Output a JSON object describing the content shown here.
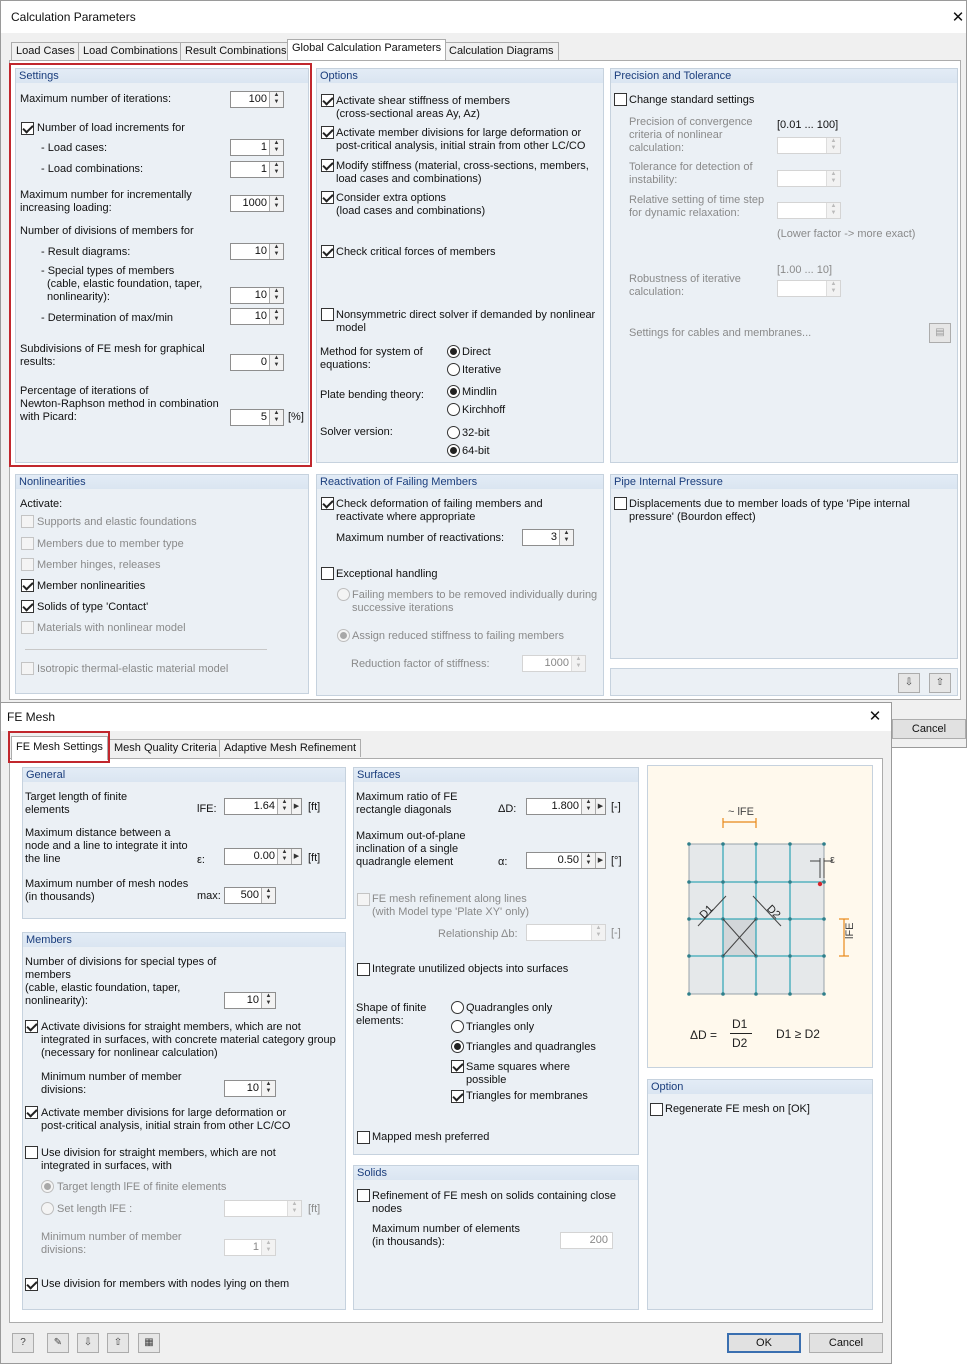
{
  "calc": {
    "title": "Calculation Parameters",
    "close": "✕",
    "tabs": [
      "Load Cases",
      "Load Combinations",
      "Result Combinations",
      "Global Calculation Parameters",
      "Calculation Diagrams"
    ],
    "settings": {
      "header": "Settings",
      "max_iter_label": "Maximum number of iterations:",
      "max_iter": "100",
      "num_load_inc_label": "Number of load increments for",
      "load_cases_label": "- Load cases:",
      "load_cases": "1",
      "load_combos_label": "- Load combinations:",
      "load_combos": "1",
      "max_incr_label1": "Maximum number for incrementally",
      "max_incr_label2": "increasing loading:",
      "max_incr": "1000",
      "divisions_label": "Number of divisions of members for",
      "result_diag_label": "- Result diagrams:",
      "result_diag": "10",
      "special_l1": "- Special types of members",
      "special_l2": "(cable, elastic foundation, taper,",
      "special_l3": "nonlinearity):",
      "special": "10",
      "maxmin_label": "- Determination of max/min",
      "maxmin": "10",
      "subdiv_l1": "Subdivisions of FE mesh for graphical",
      "subdiv_l2": "results:",
      "subdiv": "0",
      "pct_l1": "Percentage of iterations of",
      "pct_l2": "Newton-Raphson method in combination",
      "pct_l3": "with Picard:",
      "pct": "5",
      "pct_unit": "[%]"
    },
    "options": {
      "header": "Options",
      "shear_l1": "Activate shear stiffness of members",
      "shear_l2": "(cross-sectional areas Ay, Az)",
      "div_l1": "Activate member divisions for large deformation or",
      "div_l2": "post-critical analysis, initial strain from other LC/CO",
      "mod_l1": "Modify stiffness (material, cross-sections, members,",
      "mod_l2": "load cases and combinations)",
      "extra_l1": "Consider extra options",
      "extra_l2": "(load cases and combinations)",
      "crit": "Check critical forces of members",
      "nonsym_l1": "Nonsymmetric direct solver if demanded by nonlinear",
      "nonsym_l2": "model",
      "method_l1": "Method for system of",
      "method_l2": "equations:",
      "direct": "Direct",
      "iterative": "Iterative",
      "plate_label": "Plate bending theory:",
      "mindlin": "Mindlin",
      "kirchhoff": "Kirchhoff",
      "solver_label": "Solver version:",
      "bit32": "32-bit",
      "bit64": "64-bit"
    },
    "precision": {
      "header": "Precision and Tolerance",
      "change": "Change standard settings",
      "conv_l1": "Precision of convergence",
      "conv_l2": "criteria of nonlinear",
      "conv_l3": "calculation:",
      "range1": "[0.01 ... 100]",
      "tol_l1": "Tolerance for detection of",
      "tol_l2": "instability:",
      "rel_l1": "Relative setting of time step",
      "rel_l2": "for dynamic relaxation:",
      "lower": "(Lower factor -> more exact)",
      "range2": "[1.00 ... 10]",
      "rob_l1": "Robustness of iterative",
      "rob_l2": "calculation:",
      "cables": "Settings for cables and membranes..."
    },
    "nonlin": {
      "header": "Nonlinearities",
      "activate": "Activate:",
      "supports": "Supports and elastic foundations",
      "members_type": "Members due to member type",
      "hinges": "Member hinges, releases",
      "member_nl": "Member nonlinearities",
      "solids": "Solids of type 'Contact'",
      "materials": "Materials with nonlinear model",
      "isotropic": "Isotropic thermal-elastic material model"
    },
    "react": {
      "header": "Reactivation of Failing Members",
      "check_l1": "Check deformation of failing members and",
      "check_l2": "reactivate where appropriate",
      "max_react_label": "Maximum number of reactivations:",
      "max_react": "3",
      "exceptional": "Exceptional handling",
      "fail_l1": "Failing members to be removed individually during",
      "fail_l2": "successive iterations",
      "assign": "Assign reduced stiffness to failing members",
      "reduction_label": "Reduction factor of stiffness:",
      "reduction": "1000"
    },
    "pipe": {
      "header": "Pipe Internal Pressure",
      "disp_l1": "Displacements due to member loads of type 'Pipe internal",
      "disp_l2": "pressure' (Bourdon effect)"
    },
    "cancel": "Cancel"
  },
  "fe": {
    "title": "FE Mesh",
    "close": "✕",
    "tabs": [
      "FE Mesh Settings",
      "Mesh Quality Criteria",
      "Adaptive Mesh Refinement"
    ],
    "general": {
      "header": "General",
      "target_l1": "Target length of finite",
      "target_l2": "elements",
      "target_sym": "lFE:",
      "target": "1.64",
      "target_unit": "[ft]",
      "maxdist_l1": "Maximum distance between a",
      "maxdist_l2": "node and a line to integrate it into",
      "maxdist_l3": "the line",
      "maxdist_sym": "ε:",
      "maxdist": "0.00",
      "maxdist_unit": "[ft]",
      "nodes_l1": "Maximum number of mesh nodes",
      "nodes_l2": "(in thousands)",
      "nodes_sym": "max:",
      "nodes": "500"
    },
    "members": {
      "header": "Members",
      "special_l1": "Number of divisions for special types of",
      "special_l2": "members",
      "special_l3": "(cable, elastic foundation, taper,",
      "special_l4": "nonlinearity):",
      "special": "10",
      "act_l1": "Activate divisions for straight members, which are not",
      "act_l2": "integrated in surfaces, with concrete material category group",
      "act_l3": "(necessary for nonlinear calculation)",
      "min_l1": "Minimum number of member",
      "min_l2": "divisions:",
      "min": "10",
      "large_l1": "Activate member divisions for large deformation or",
      "large_l2": "post-critical analysis, initial strain from other LC/CO",
      "use_l1": "Use division for straight members, which are not",
      "use_l2": "integrated in surfaces, with",
      "target_len": "Target length lFE of finite elements",
      "set_len": "Set length lFE :",
      "set_unit": "[ft]",
      "min2_l1": "Minimum number of member",
      "min2_l2": "divisions:",
      "min2": "1",
      "nodes_lying": "Use division for members with nodes lying on them"
    },
    "surfaces": {
      "header": "Surfaces",
      "ratio_l1": "Maximum ratio of FE",
      "ratio_l2": "rectangle diagonals",
      "ratio_sym": "ΔD:",
      "ratio": "1.800",
      "ratio_unit": "[-]",
      "oop_l1": "Maximum out-of-plane",
      "oop_l2": "inclination of a single",
      "oop_l3": "quadrangle element",
      "oop_sym": "α:",
      "oop": "0.50",
      "oop_unit": "[°]",
      "refine_l1": "FE mesh refinement along lines",
      "refine_l2": "(with Model type 'Plate XY' only)",
      "rel_label": "Relationship",
      "rel_sym": "Δb:",
      "rel_unit": "[-]",
      "integrate": "Integrate unutilized objects into surfaces",
      "shape_l1": "Shape of finite",
      "shape_l2": "elements:",
      "quads": "Quadrangles only",
      "tris": "Triangles only",
      "both": "Triangles and quadrangles",
      "same_l1": "Same squares where",
      "same_l2": "possible",
      "membranes": "Triangles for membranes",
      "mapped": "Mapped mesh preferred"
    },
    "solids": {
      "header": "Solids",
      "ref_l1": "Refinement of FE mesh on solids containing close",
      "ref_l2": "nodes",
      "max_l1": "Maximum number of elements",
      "max_l2": "(in thousands):",
      "max": "200"
    },
    "diagram": {
      "lfe": "~ lFE",
      "eps": "ε",
      "lfe_side": "lFE",
      "d1": "D1",
      "d2": "D2",
      "formula_lhs": "ΔD =",
      "frac_top": "D1",
      "frac_bot": "D2",
      "cond": "D1 ≥ D2"
    },
    "option": {
      "header": "Option",
      "regen": "Regenerate FE mesh on [OK]"
    },
    "ok": "OK",
    "cancel": "Cancel"
  },
  "colors": {
    "accent_red": "#c1272d",
    "panel_header_text": "#1a3d7c",
    "mesh_line": "#39a9b8",
    "dim_orange": "#e8891a"
  }
}
